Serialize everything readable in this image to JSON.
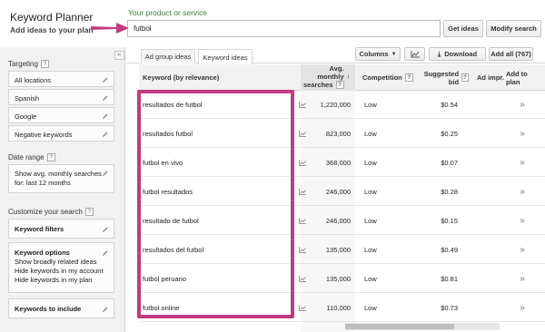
{
  "header": {
    "title": "Keyword Planner",
    "subtitle": "Add ideas to your plan",
    "product_label": "Your product or service",
    "search_value": "futbol",
    "get_ideas_label": "Get ideas",
    "modify_search_label": "Modify search"
  },
  "sidebar": {
    "collapse_label": "«",
    "targeting_label": "Targeting",
    "targeting_items": [
      "All locations",
      "Spanish",
      "Google",
      "Negative keywords"
    ],
    "date_range_label": "Date range",
    "date_range_text": "Show avg. monthly searches for: last 12 months",
    "customize_label": "Customize your search",
    "keyword_filters_label": "Keyword filters",
    "keyword_options_label": "Keyword options",
    "keyword_options_lines": [
      "Show broadly related ideas",
      "Hide keywords in my account",
      "Hide keywords in my plan"
    ],
    "keywords_include_label": "Keywords to include",
    "help_glyph": "?"
  },
  "tabs": {
    "ad_group": "Ad group ideas",
    "keyword": "Keyword ideas"
  },
  "toolbar": {
    "columns_label": "Columns",
    "download_label": "Download",
    "add_all_label": "Add all (767)"
  },
  "table": {
    "headers": {
      "keyword": "Keyword (by relevance)",
      "avg_line1": "Avg.",
      "avg_line2": "monthly",
      "avg_line3": "searches",
      "competition": "Competition",
      "bid": "Suggested bid",
      "ad_impr": "Ad impr.",
      "add_to_plan": "Add to plan"
    },
    "add_glyph": "»",
    "rows": [
      {
        "keyword": "resultados de futbol",
        "searches": "1,220,000",
        "competition": "Low",
        "bid": "$0.54"
      },
      {
        "keyword": "resultados futbol",
        "searches": "823,000",
        "competition": "Low",
        "bid": "$0.25"
      },
      {
        "keyword": "futbol en vivo",
        "searches": "368,000",
        "competition": "Low",
        "bid": "$0.07"
      },
      {
        "keyword": "futbol resultados",
        "searches": "246,000",
        "competition": "Low",
        "bid": "$0.28"
      },
      {
        "keyword": "resultado de futbol",
        "searches": "246,000",
        "competition": "Low",
        "bid": "$0.15"
      },
      {
        "keyword": "resultados del futbol",
        "searches": "135,000",
        "competition": "Low",
        "bid": "$0.49"
      },
      {
        "keyword": "futbol peruano",
        "searches": "135,000",
        "competition": "Low",
        "bid": "$0.81"
      },
      {
        "keyword": "futbol online",
        "searches": "110,000",
        "competition": "Low",
        "bid": "$0.73"
      }
    ]
  },
  "colors": {
    "highlight": "#c33a80",
    "product_label": "#3b7d3b"
  }
}
